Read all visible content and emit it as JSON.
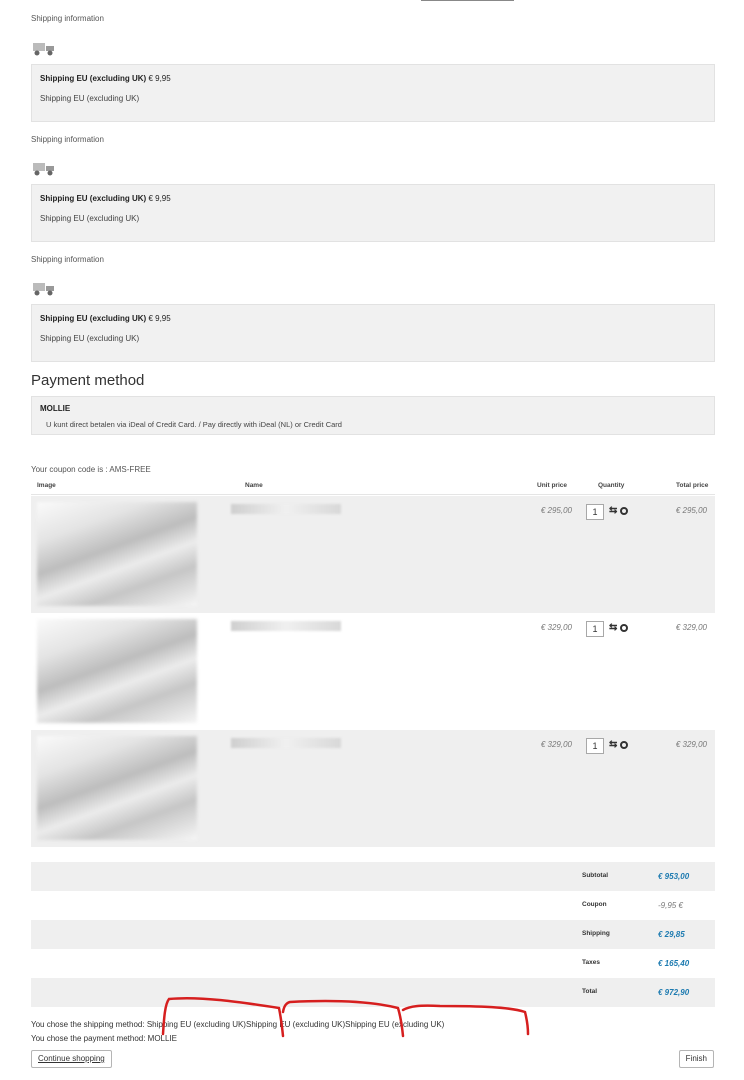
{
  "shipping_blocks": [
    {
      "heading": "Shipping information",
      "icon": "truck-icon",
      "method_name": "Shipping EU (excluding UK)",
      "price": "€ 9,95",
      "description": "Shipping EU (excluding UK)"
    },
    {
      "heading": "Shipping information",
      "icon": "truck-icon",
      "method_name": "Shipping EU (excluding UK)",
      "price": "€ 9,95",
      "description": "Shipping EU (excluding UK)"
    },
    {
      "heading": "Shipping information",
      "icon": "truck-icon",
      "method_name": "Shipping EU (excluding UK)",
      "price": "€ 9,95",
      "description": "Shipping EU (excluding UK)"
    }
  ],
  "payment": {
    "title": "Payment method",
    "method_name": "MOLLIE",
    "description": "U kunt direct betalen via iDeal of Credit Card. / Pay directly with iDeal (NL) or Credit Card"
  },
  "coupon_note": "Your coupon code is : AMS-FREE",
  "cart": {
    "columns": {
      "image": "Image",
      "name": "Name",
      "unit_price": "Unit price",
      "quantity": "Quantity",
      "total_price": "Total price"
    },
    "rows": [
      {
        "unit_price": "€ 295,00",
        "quantity": "1",
        "total_price": "€ 295,00"
      },
      {
        "unit_price": "€ 329,00",
        "quantity": "1",
        "total_price": "€ 329,00"
      },
      {
        "unit_price": "€ 329,00",
        "quantity": "1",
        "total_price": "€ 329,00"
      }
    ]
  },
  "totals": [
    {
      "label": "Subtotal",
      "value": "€ 953,00"
    },
    {
      "label": "Coupon",
      "value": "-9,95 €"
    },
    {
      "label": "Shipping",
      "value": "€ 29,85"
    },
    {
      "label": "Taxes",
      "value": "€ 165,40"
    },
    {
      "label": "Total",
      "value": "€ 972,90"
    }
  ],
  "summary": {
    "shipping_prefix": "You chose the shipping method:",
    "shipping_methods": [
      "Shipping EU (excluding UK)",
      "Shipping EU (excluding UK)",
      "Shipping EU (excluding UK)"
    ],
    "payment_line": "You chose the payment method: MOLLIE"
  },
  "buttons": {
    "continue": "Continue shopping",
    "finish": "Finish"
  },
  "colors": {
    "accent_total": "#1c7ab0",
    "annotation": "#d61f1f",
    "row_bg": "#efefef"
  }
}
